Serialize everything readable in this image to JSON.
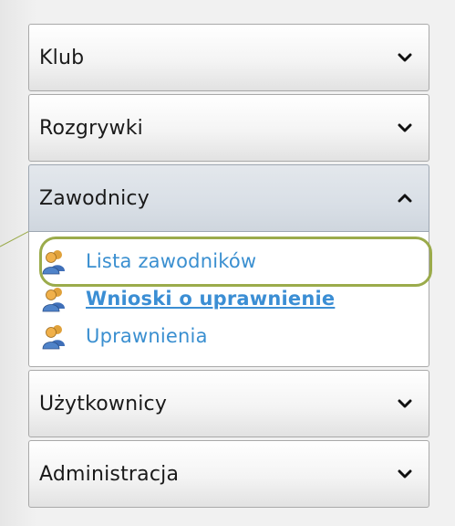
{
  "accordion": {
    "sections": [
      {
        "label": "Klub",
        "state": "collapsed"
      },
      {
        "label": "Rozgrywki",
        "state": "collapsed"
      },
      {
        "label": "Zawodnicy",
        "state": "expanded"
      },
      {
        "label": "Użytkownicy",
        "state": "collapsed"
      },
      {
        "label": "Administracja",
        "state": "collapsed"
      }
    ],
    "zawodnicy_links": [
      {
        "label": "Lista zawodników",
        "icon": "user-group-icon",
        "highlighted": true
      },
      {
        "label": "Wnioski o uprawnienie",
        "icon": "user-group-icon",
        "active": true
      },
      {
        "label": "Uprawnienia",
        "icon": "user-group-icon"
      }
    ]
  },
  "colors": {
    "link": "#3a8fd0",
    "highlight_ring": "#9bab4b",
    "header_border": "#a9a9a9",
    "open_header_bg": "#d9dfe6"
  }
}
